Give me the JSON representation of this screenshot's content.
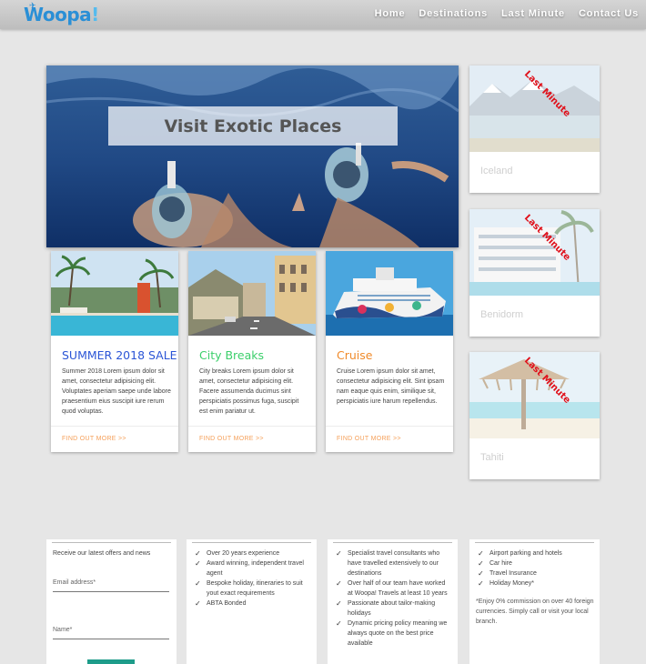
{
  "header": {
    "logo_text": "Woopa",
    "logo_excl": "!",
    "nav": [
      "Home",
      "Destinations",
      "Last Minute",
      "Contact Us"
    ]
  },
  "hero": {
    "title": "Visit Exotic Places"
  },
  "cards": [
    {
      "title": "SUMMER 2018 SALE",
      "title_color": "#2b55d6",
      "text": "Summer 2018 Lorem ipsum dolor sit amet, consectetur adipisicing elit. Voluptates aperiam saepe unde labore praesentium eius suscipit iure rerum quod voluptas.",
      "link": "FIND OUT MORE >>"
    },
    {
      "title": "City Breaks",
      "title_color": "#3ccf6b",
      "text": "City breaks Lorem ipsum dolor sit amet, consectetur adipisicing elit. Facere assumenda ducimus sint perspiciatis possimus fuga, suscipit est enim pariatur ut.",
      "link": "FIND OUT MORE >>"
    },
    {
      "title": "Cruise",
      "title_color": "#f08a2a",
      "text": "Cruise Lorem ipsum dolor sit amet, consectetur adipisicing elit. Sint ipsam nam eaque quis enim, similique sit, perspiciatis iure harum repellendus.",
      "link": "FIND OUT MORE >>"
    }
  ],
  "last_minute": {
    "ribbon": "Last Minute",
    "items": [
      {
        "label": "Iceland"
      },
      {
        "label": "Benidorm"
      },
      {
        "label": "Tahiti"
      }
    ]
  },
  "newsletter": {
    "title": "Receive our latest offers and news",
    "email_placeholder": "Email address*",
    "name_placeholder": "Name*"
  },
  "features_1": [
    "Over 20 years experience",
    "Award winning, independent travel agent",
    "Bespoke holiday, itineraries to suit yout exact requirements",
    "ABTA Bonded"
  ],
  "features_2": [
    "Specialist travel consultants who have travelled extensively to our destinations",
    "Over half of our team have worked at Woopa! Travels at least 10 years",
    "Passionate about tailor-making holidays",
    "Dynamic pricing policy meaning we always quote on the best price available"
  ],
  "features_3": {
    "items": [
      "Airport parking and hotels",
      "Car hire",
      "Travel Insurance",
      "Holiday Money*"
    ],
    "note": "*Enjoy 0% commission on over 40 foreign currencies. Simply call or visit your local branch."
  }
}
